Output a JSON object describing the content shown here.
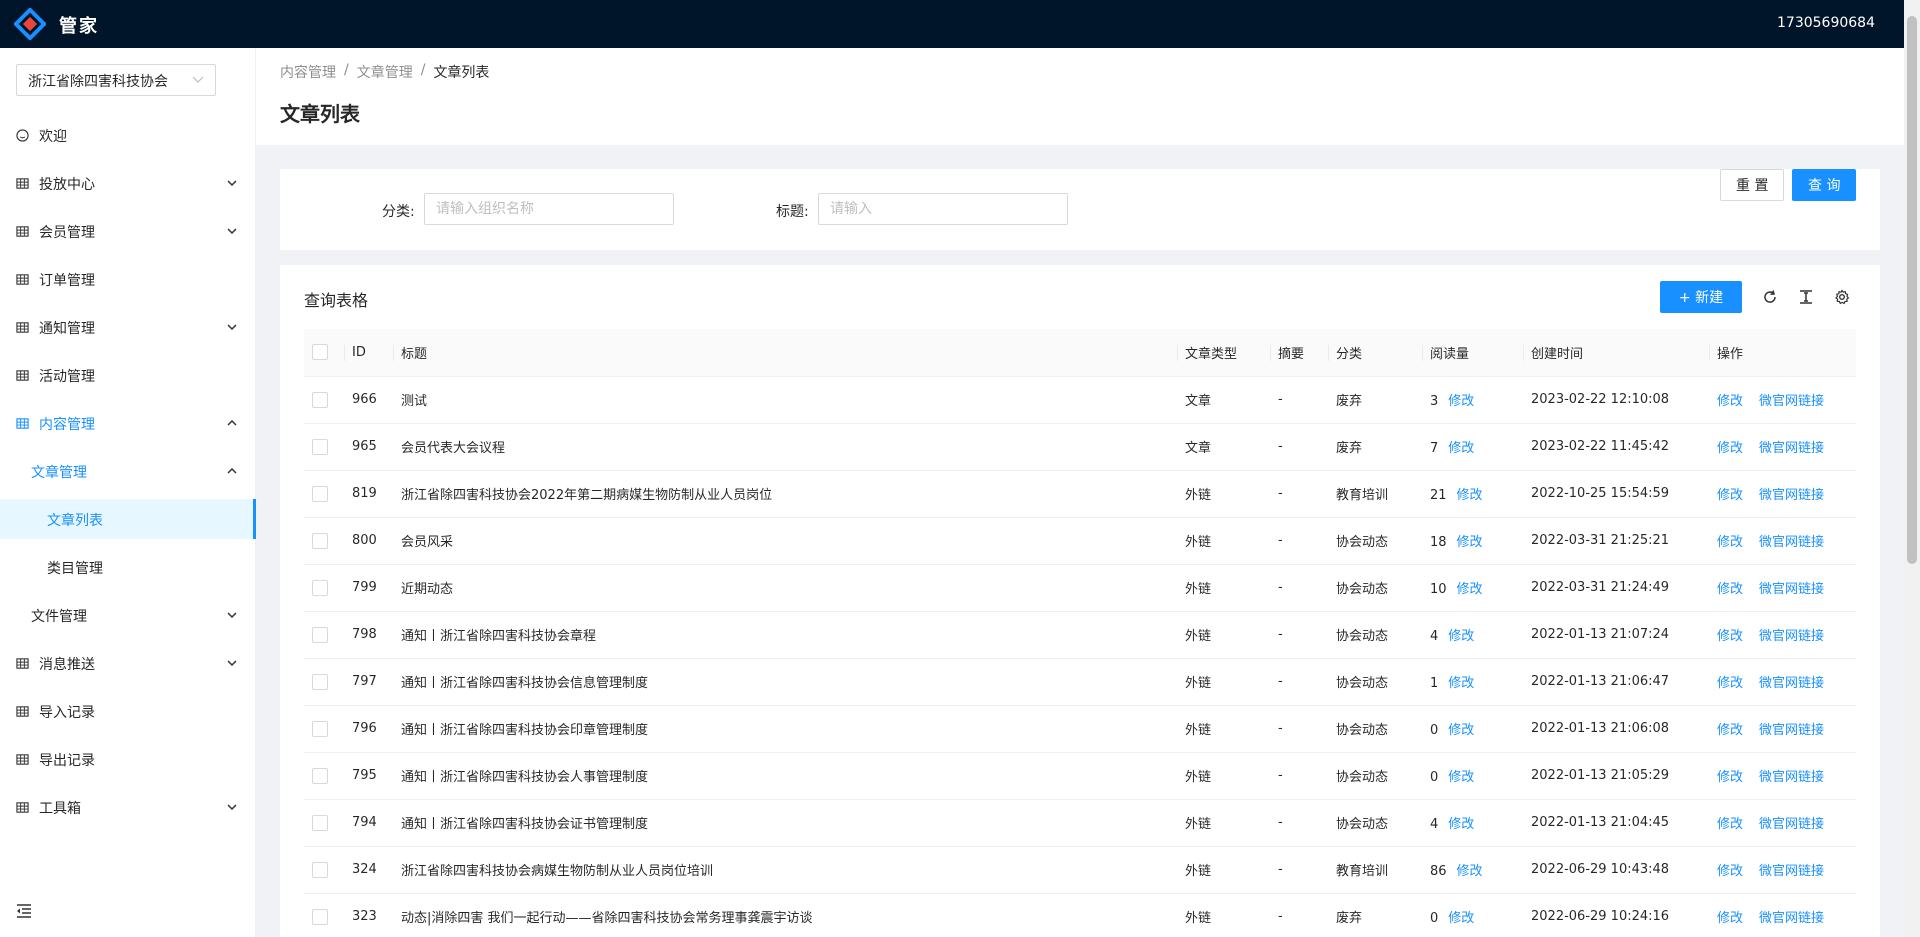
{
  "app": {
    "brand": "管家",
    "user": "17305690684"
  },
  "sidebar": {
    "org": "浙江省除四害科技协会",
    "items": [
      {
        "label": "欢迎"
      },
      {
        "label": "投放中心"
      },
      {
        "label": "会员管理"
      },
      {
        "label": "订单管理"
      },
      {
        "label": "通知管理"
      },
      {
        "label": "活动管理"
      },
      {
        "label": "内容管理"
      },
      {
        "label": "文章管理"
      },
      {
        "label": "文章列表"
      },
      {
        "label": "类目管理"
      },
      {
        "label": "文件管理"
      },
      {
        "label": "消息推送"
      },
      {
        "label": "导入记录"
      },
      {
        "label": "导出记录"
      },
      {
        "label": "工具箱"
      }
    ]
  },
  "breadcrumb": [
    "内容管理",
    "文章管理",
    "文章列表"
  ],
  "page_title": "文章列表",
  "search": {
    "category_label": "分类:",
    "category_placeholder": "请输入组织名称",
    "title_label": "标题:",
    "title_placeholder": "请输入",
    "reset": "重 置",
    "query": "查 询"
  },
  "table": {
    "title": "查询表格",
    "new_button": "+ 新建",
    "columns": [
      "ID",
      "标题",
      "文章类型",
      "摘要",
      "分类",
      "阅读量",
      "创建时间",
      "操作"
    ],
    "edit_label": "修改",
    "wechat_label": "微官网链接",
    "rows": [
      {
        "id": "966",
        "title": "测试",
        "type": "文章",
        "summary": "-",
        "category": "废弃",
        "reads": "3",
        "created": "2023-02-22 12:10:08"
      },
      {
        "id": "965",
        "title": "会员代表大会议程",
        "type": "文章",
        "summary": "-",
        "category": "废弃",
        "reads": "7",
        "created": "2023-02-22 11:45:42"
      },
      {
        "id": "819",
        "title": "浙江省除四害科技协会2022年第二期病媒生物防制从业人员岗位",
        "type": "外链",
        "summary": "-",
        "category": "教育培训",
        "reads": "21",
        "created": "2022-10-25 15:54:59"
      },
      {
        "id": "800",
        "title": "会员风采",
        "type": "外链",
        "summary": "-",
        "category": "协会动态",
        "reads": "18",
        "created": "2022-03-31 21:25:21"
      },
      {
        "id": "799",
        "title": "近期动态",
        "type": "外链",
        "summary": "-",
        "category": "协会动态",
        "reads": "10",
        "created": "2022-03-31 21:24:49"
      },
      {
        "id": "798",
        "title": "通知丨浙江省除四害科技协会章程",
        "type": "外链",
        "summary": "-",
        "category": "协会动态",
        "reads": "4",
        "created": "2022-01-13 21:07:24"
      },
      {
        "id": "797",
        "title": "通知丨浙江省除四害科技协会信息管理制度",
        "type": "外链",
        "summary": "-",
        "category": "协会动态",
        "reads": "1",
        "created": "2022-01-13 21:06:47"
      },
      {
        "id": "796",
        "title": "通知丨浙江省除四害科技协会印章管理制度",
        "type": "外链",
        "summary": "-",
        "category": "协会动态",
        "reads": "0",
        "created": "2022-01-13 21:06:08"
      },
      {
        "id": "795",
        "title": "通知丨浙江省除四害科技协会人事管理制度",
        "type": "外链",
        "summary": "-",
        "category": "协会动态",
        "reads": "0",
        "created": "2022-01-13 21:05:29"
      },
      {
        "id": "794",
        "title": "通知丨浙江省除四害科技协会证书管理制度",
        "type": "外链",
        "summary": "-",
        "category": "协会动态",
        "reads": "4",
        "created": "2022-01-13 21:04:45"
      },
      {
        "id": "324",
        "title": "浙江省除四害科技协会病媒生物防制从业人员岗位培训",
        "type": "外链",
        "summary": "-",
        "category": "教育培训",
        "reads": "86",
        "created": "2022-06-29 10:43:48"
      },
      {
        "id": "323",
        "title": "动态|消除四害 我们一起行动——省除四害科技协会常务理事龚震宇访谈",
        "type": "外链",
        "summary": "-",
        "category": "废弃",
        "reads": "0",
        "created": "2022-06-29 10:24:16"
      }
    ]
  },
  "colors": {
    "primary": "#1890ff",
    "header_bg": "#001529",
    "active_bg": "#e6f7ff"
  }
}
